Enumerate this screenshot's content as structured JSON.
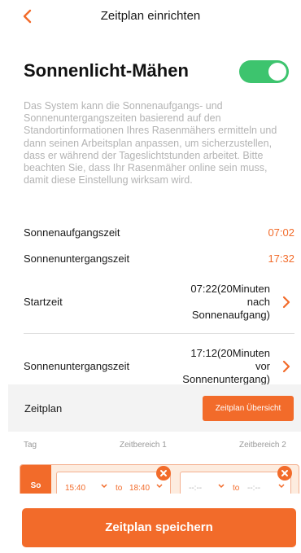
{
  "header": {
    "title": "Zeitplan einrichten",
    "back_icon": "chevron-left-icon"
  },
  "sunlight": {
    "heading": "Sonnenlicht-Mähen",
    "enabled": true,
    "description": "Das System kann die Sonnenaufgangs- und Sonnenuntergangszeiten basierend auf den Standortinformationen Ihres Rasenmähers ermitteln und dann seinen Arbeitsplan anpassen, um sicherzustellen, dass er während der Tageslichtstunden arbeitet. Bitte beachten Sie, dass Ihr Rasenmäher online sein muss, damit diese Einstellung wirksam wird."
  },
  "times": {
    "sunrise_label": "Sonnenaufgangszeit",
    "sunrise_value": "07:02",
    "sunset_label": "Sonnenuntergangszeit",
    "sunset_value": "17:32"
  },
  "start": {
    "label": "Startzeit",
    "line1": "07:22(20Minuten",
    "line2": "nach",
    "line3": "Sonnenaufgang)"
  },
  "end": {
    "label": "Sonnenuntergangszeit",
    "line1": "17:12(20Minuten",
    "line2": "vor",
    "line3": "Sonnenuntergang)"
  },
  "schedule": {
    "label": "Zeitplan",
    "overview_button": "Zeitplan Übersicht",
    "col_day": "Tag",
    "col_range1": "Zeitbereich 1",
    "col_range2": "Zeitbereich 2",
    "day": "So",
    "range1_from": "15:40",
    "range1_to_word": "to",
    "range1_to": "18:40",
    "range2_from": "--:--",
    "range2_to_word": "to",
    "range2_to": "--:--"
  },
  "footer": {
    "save_button": "Zeitplan speichern"
  },
  "colors": {
    "accent": "#f26b2a",
    "toggle_on": "#3dc46e"
  }
}
